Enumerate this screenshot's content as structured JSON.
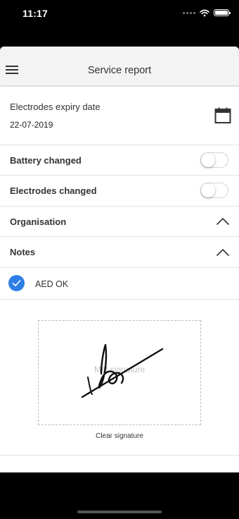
{
  "status_bar": {
    "time": "11:17"
  },
  "app_bar": {
    "title": "Service report"
  },
  "form": {
    "electrodes_expiry_label": "Electrodes expiry date",
    "electrodes_expiry_value": "22-07-2019",
    "battery_changed_label": "Battery changed",
    "battery_changed_on": false,
    "electrodes_changed_label": "Electrodes changed",
    "electrodes_changed_on": false,
    "organisation_label": "Organisation",
    "organisation_expanded": true,
    "notes_label": "Notes",
    "notes_expanded": true,
    "aed_ok_label": "AED OK",
    "aed_ok_checked": true
  },
  "signature": {
    "placeholder": "Mitt signature",
    "clear_label": "Clear signature"
  },
  "colors": {
    "accent": "#2e7fe6",
    "app_bar_bg": "#f3f3f3",
    "divider": "#e3e3e3"
  },
  "icons": {
    "menu": "hamburger-icon",
    "calendar": "calendar-icon",
    "collapse": "chevron-up-icon",
    "check": "checkmark-icon",
    "wifi": "wifi-icon",
    "battery": "battery-icon"
  }
}
